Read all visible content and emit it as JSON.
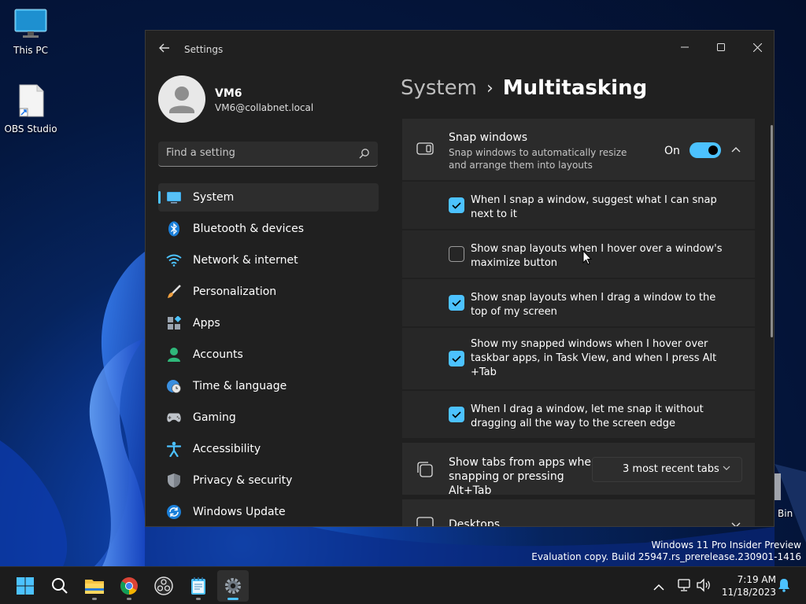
{
  "desktop": {
    "icons": [
      {
        "label": "This PC"
      },
      {
        "label": "OBS Studio"
      }
    ],
    "recycle_partial": "Bin"
  },
  "window": {
    "title": "Settings",
    "back_icon": "back-arrow-icon",
    "controls": [
      "minimize",
      "maximize",
      "close"
    ]
  },
  "profile": {
    "name": "VM6",
    "email": "VM6@collabnet.local"
  },
  "search": {
    "placeholder": "Find a setting"
  },
  "nav": [
    {
      "label": "System",
      "icon": "system-icon",
      "active": true
    },
    {
      "label": "Bluetooth & devices",
      "icon": "bluetooth-icon"
    },
    {
      "label": "Network & internet",
      "icon": "wifi-icon"
    },
    {
      "label": "Personalization",
      "icon": "brush-icon"
    },
    {
      "label": "Apps",
      "icon": "apps-icon"
    },
    {
      "label": "Accounts",
      "icon": "person-icon"
    },
    {
      "label": "Time & language",
      "icon": "globe-clock-icon"
    },
    {
      "label": "Gaming",
      "icon": "gamepad-icon"
    },
    {
      "label": "Accessibility",
      "icon": "accessibility-icon"
    },
    {
      "label": "Privacy & security",
      "icon": "shield-icon"
    },
    {
      "label": "Windows Update",
      "icon": "update-icon"
    }
  ],
  "breadcrumb": {
    "parent": "System",
    "separator": "›",
    "current": "Multitasking"
  },
  "snap": {
    "title": "Snap windows",
    "description": "Snap windows to automatically resize and arrange them into layouts",
    "toggle_state": "On",
    "toggle_on": true,
    "options": [
      {
        "text": "When I snap a window, suggest what I can snap next to it",
        "checked": true
      },
      {
        "text": "Show snap layouts when I hover over a window's maximize button",
        "checked": false
      },
      {
        "text": "Show snap layouts when I drag a window to the top of my screen",
        "checked": true
      },
      {
        "text": "Show my snapped windows when I hover over taskbar apps, in Task View, and when I press Alt +Tab",
        "checked": true
      },
      {
        "text": "When I drag a window, let me snap it without dragging all the way to the screen edge",
        "checked": true
      }
    ]
  },
  "tabs_setting": {
    "label": "Show tabs from apps when snapping or pressing Alt+Tab",
    "value": "3 most recent tabs"
  },
  "desktops": {
    "label": "Desktops"
  },
  "watermark": {
    "line1": "Windows 11 Pro Insider Preview",
    "line2": "Evaluation copy. Build 25947.rs_prerelease.230901-1416"
  },
  "taskbar": {
    "apps": [
      "start-icon",
      "search-icon",
      "file-explorer-icon",
      "chrome-icon",
      "obs-icon",
      "notepad-icon",
      "settings-icon"
    ],
    "clock_time": "7:19 AM",
    "clock_date": "11/18/2023"
  },
  "colors": {
    "accent": "#4cc2ff",
    "window_bg": "#202020",
    "card_bg": "#2b2b2b"
  }
}
